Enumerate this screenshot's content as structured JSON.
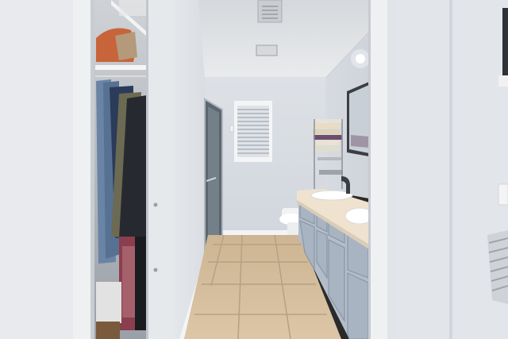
{
  "scene": {
    "kind": "photograph",
    "subject": "bathroom-with-walk-in-closet",
    "colors": {
      "wall_light": "#e9ecef",
      "wall_mid": "#d7dbe0",
      "wall_shadow": "#c7ccd2",
      "ceiling": "#e4e6e8",
      "floor_tile": "#d8c2a2",
      "floor_grout": "#b79f80",
      "counter": "#efe3cf",
      "cabinet": "#aeb8c6",
      "cabinet_dark": "#8e99a8",
      "door_trim": "#eef0f2",
      "closet_dark": "#1f2730"
    }
  }
}
